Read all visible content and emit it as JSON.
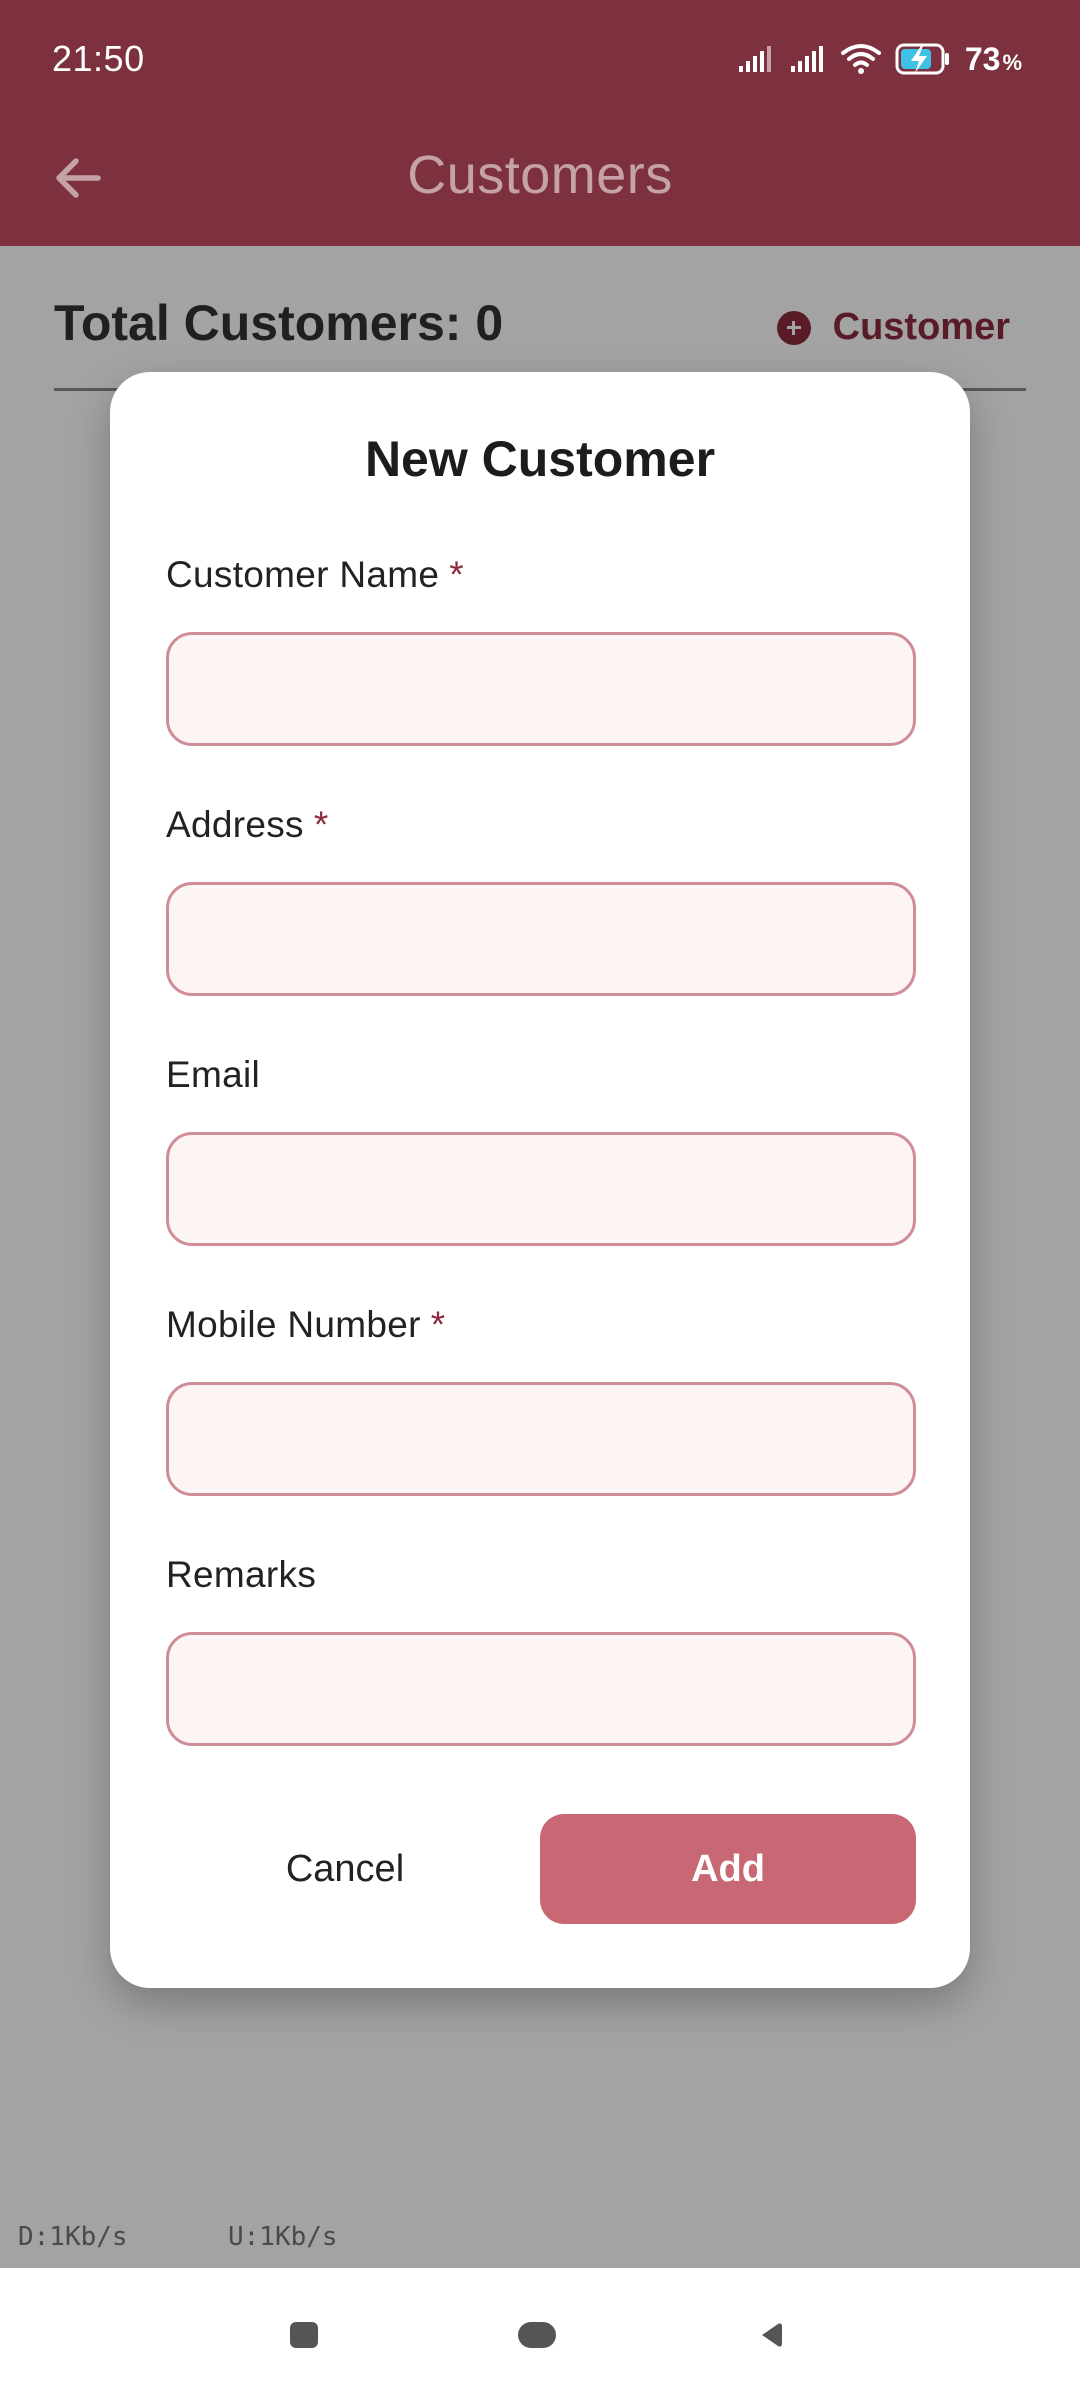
{
  "status_bar": {
    "time": "21:50",
    "battery_percent": "73",
    "battery_unit": "%"
  },
  "toolbar": {
    "title": "Customers"
  },
  "content": {
    "total_customers": "Total Customers: 0",
    "add_customer_label": "Customer"
  },
  "dialog": {
    "title": "New Customer",
    "fields": [
      {
        "label": "Customer Name",
        "required_mark": "*",
        "value": "",
        "placeholder": ""
      },
      {
        "label": "Address",
        "required_mark": "*",
        "value": "",
        "placeholder": ""
      },
      {
        "label": "Email",
        "required_mark": "",
        "value": "",
        "placeholder": ""
      },
      {
        "label": "Mobile Number",
        "required_mark": "*",
        "value": "",
        "placeholder": ""
      },
      {
        "label": "Remarks",
        "required_mark": "",
        "value": "",
        "placeholder": ""
      }
    ],
    "cancel_label": "Cancel",
    "add_label": "Add"
  },
  "debug_overlay": {
    "download": "D:1Kb/s",
    "upload": "U:1Kb/s"
  },
  "colors": {
    "brand": "#7d313f",
    "accent": "#8a2b3d",
    "button": "#c76874",
    "input_border": "#d18d97",
    "input_fill": "#fdf4f4"
  }
}
